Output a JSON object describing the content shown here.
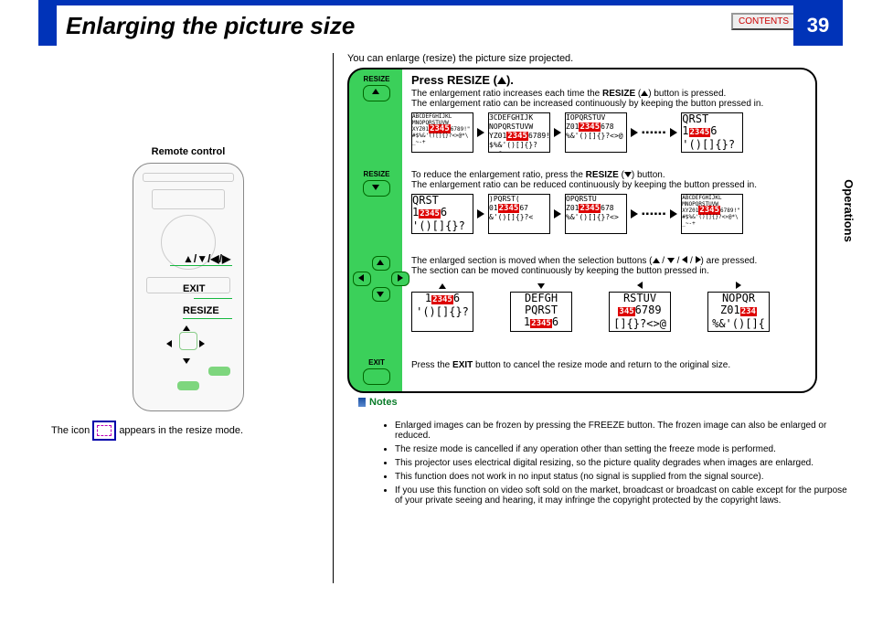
{
  "page": {
    "title": "Enlarging the picture size",
    "number": "39",
    "side_tab": "Operations",
    "contents_button": "CONTENTS"
  },
  "intro": "You can enlarge (resize) the picture size projected.",
  "left": {
    "remote_label": "Remote control",
    "arrows_caption": "▲/▼/◀/▶",
    "exit_caption": "EXIT",
    "resize_caption": "RESIZE",
    "icon_note_prefix": "The icon ",
    "icon_note_suffix": " appears in the resize mode."
  },
  "steps": {
    "label_resize": "RESIZE",
    "label_exit": "EXIT",
    "s1": {
      "heading_before": "Press RESIZE (",
      "heading_after": ").",
      "line1a": "The enlargement ratio increases each time the ",
      "line1b": "RESIZE",
      "line1c": " (",
      "line1d": ") button is pressed.",
      "line2": "The enlargement ratio can be increased continuously by keeping the button pressed in."
    },
    "s2": {
      "line1a": "To reduce the enlargement ratio, press the ",
      "line1b": "RESIZE",
      "line1c": " (",
      "line1d": ") button.",
      "line2": "The enlargement ratio can be reduced continuously by keeping the button pressed in."
    },
    "s3": {
      "line1a": "The enlarged section is moved when the selection buttons (",
      "line1b": " / ",
      "line1c": " / ",
      "line1d": " / ",
      "line1e": ") are pressed.",
      "line2": "The section can be moved continuously by keeping the button pressed in."
    },
    "s4": {
      "line1a": "Press the ",
      "line1b": "EXIT",
      "line1c": " button to cancel the resize mode and return to the original size."
    },
    "samples": {
      "full_lines": "ABCDEFGHIJKL MNOPQRSTUVW XYZ012345 6789!\" #$%&'()[]{}?<>@*\\ _~-+",
      "hl": "2345",
      "z4": "012345678",
      "z5": "12345",
      "z6": "23456"
    }
  },
  "notes": {
    "heading": "Notes",
    "n1": "Enlarged images can be frozen by pressing the FREEZE button. The frozen image can also be enlarged or reduced.",
    "n2": "The resize mode is cancelled if any operation other than setting the freeze mode is performed.",
    "n3": "This projector uses electrical digital resizing, so the picture quality degrades when images are enlarged.",
    "n4": "This function does not work in no input status (no signal is supplied from the signal source).",
    "n5": "If you use this function on video soft sold on the market, broadcast or broadcast on cable except for the purpose of your private seeing and hearing, it may infringe the copyright protected by the copyright laws."
  }
}
